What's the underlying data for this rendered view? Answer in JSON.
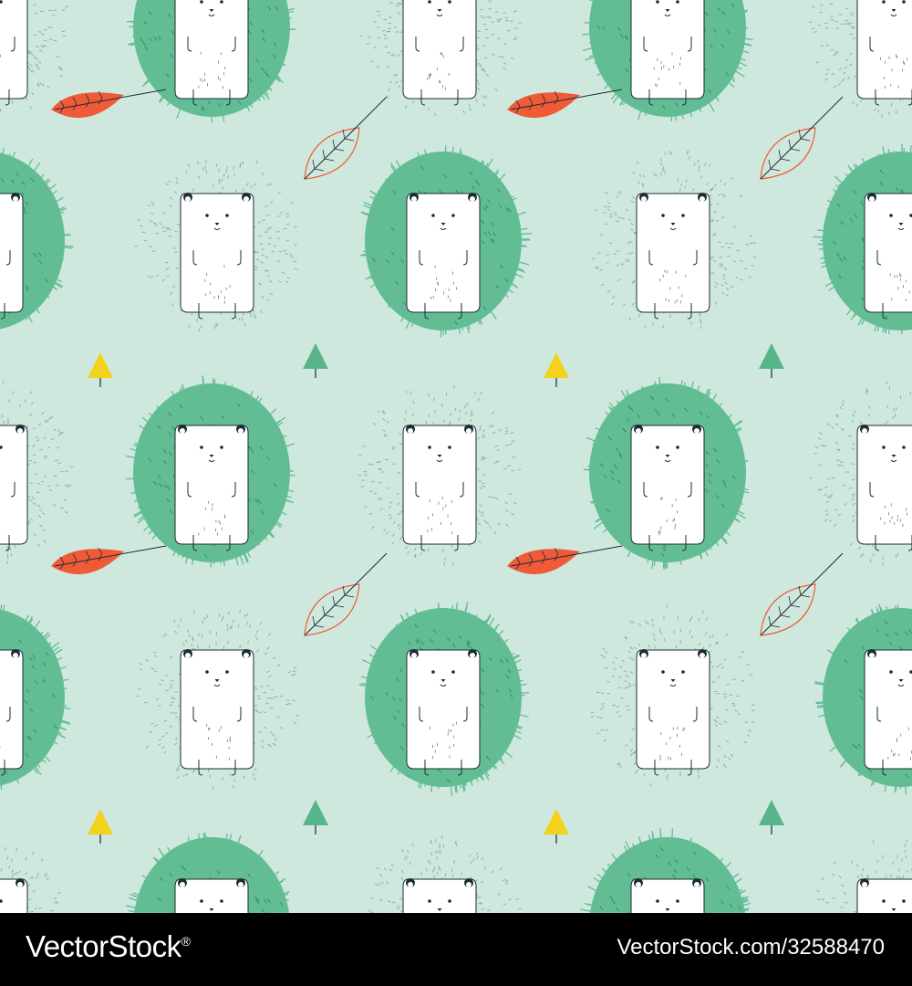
{
  "colors": {
    "background": "#cfe8de",
    "spine_fill": "#62bd95",
    "spine_stroke": "#2f8f67",
    "body": "#ffffff",
    "outline": "#1d2b35",
    "leaf_red": "#ef5a37",
    "tree_yellow": "#f3d21e",
    "tree_green": "#58b58a",
    "footer_bg": "#000000",
    "footer_text": "#ffffff"
  },
  "icons": [
    "hedgehog-icon",
    "leaf-icon",
    "tree-icon"
  ],
  "footer": {
    "brand": "VectorStock",
    "brand_mark": "®",
    "url": "VectorStock.com/32588470"
  }
}
